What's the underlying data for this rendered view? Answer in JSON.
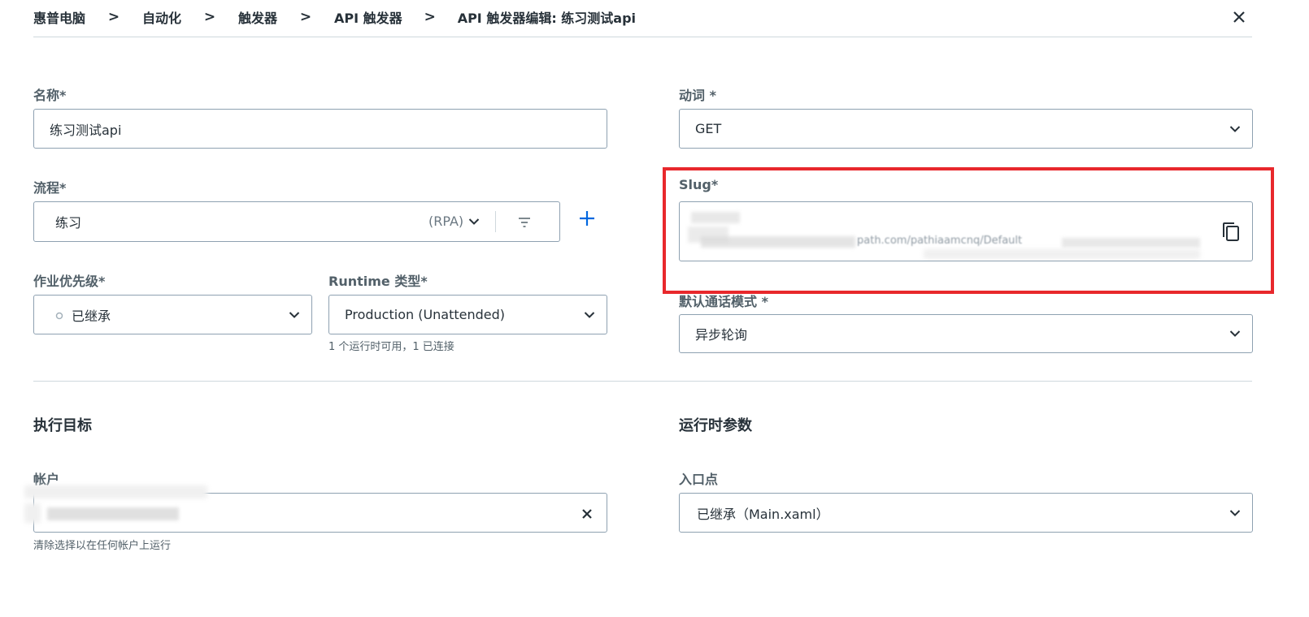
{
  "breadcrumb": {
    "items": [
      "惠普电脑",
      "自动化",
      "触发器",
      "API 触发器"
    ],
    "current": "API 触发器编辑: 练习测试api",
    "separator": ">"
  },
  "name_field": {
    "label": "名称*",
    "value": "练习测试api"
  },
  "process_field": {
    "label": "流程*",
    "value": "练习",
    "tag": "(RPA)"
  },
  "priority_field": {
    "label": "作业优先级*",
    "value": "已继承"
  },
  "runtime_field": {
    "label": "Runtime 类型*",
    "value": "Production (Unattended)",
    "helper": "1 个运行时可用，1 已连接"
  },
  "verb_field": {
    "label": "动词 *",
    "value": "GET"
  },
  "slug_field": {
    "label": "Slug*",
    "value_partial": "path.com/pathiaamcnq/Default"
  },
  "call_mode_field": {
    "label": "默认通话模式 *",
    "value": "异步轮询"
  },
  "target_section": {
    "title": "执行目标",
    "account_label": "帐户",
    "helper": "清除选择以在任何帐户上运行"
  },
  "runtime_params_section": {
    "title": "运行时参数",
    "entry_label": "入口点",
    "entry_value": "已继承（Main.xaml）"
  },
  "colors": {
    "accent": "#0067df",
    "highlight": "#e8282c",
    "border": "#8ea1b1",
    "text": "#273139",
    "label": "#526069"
  },
  "icons": {
    "close": "close-icon",
    "chevron": "chevron-down-icon",
    "filter": "filter-icon",
    "add": "plus-icon",
    "copy": "copy-icon",
    "status": "circle-icon"
  }
}
